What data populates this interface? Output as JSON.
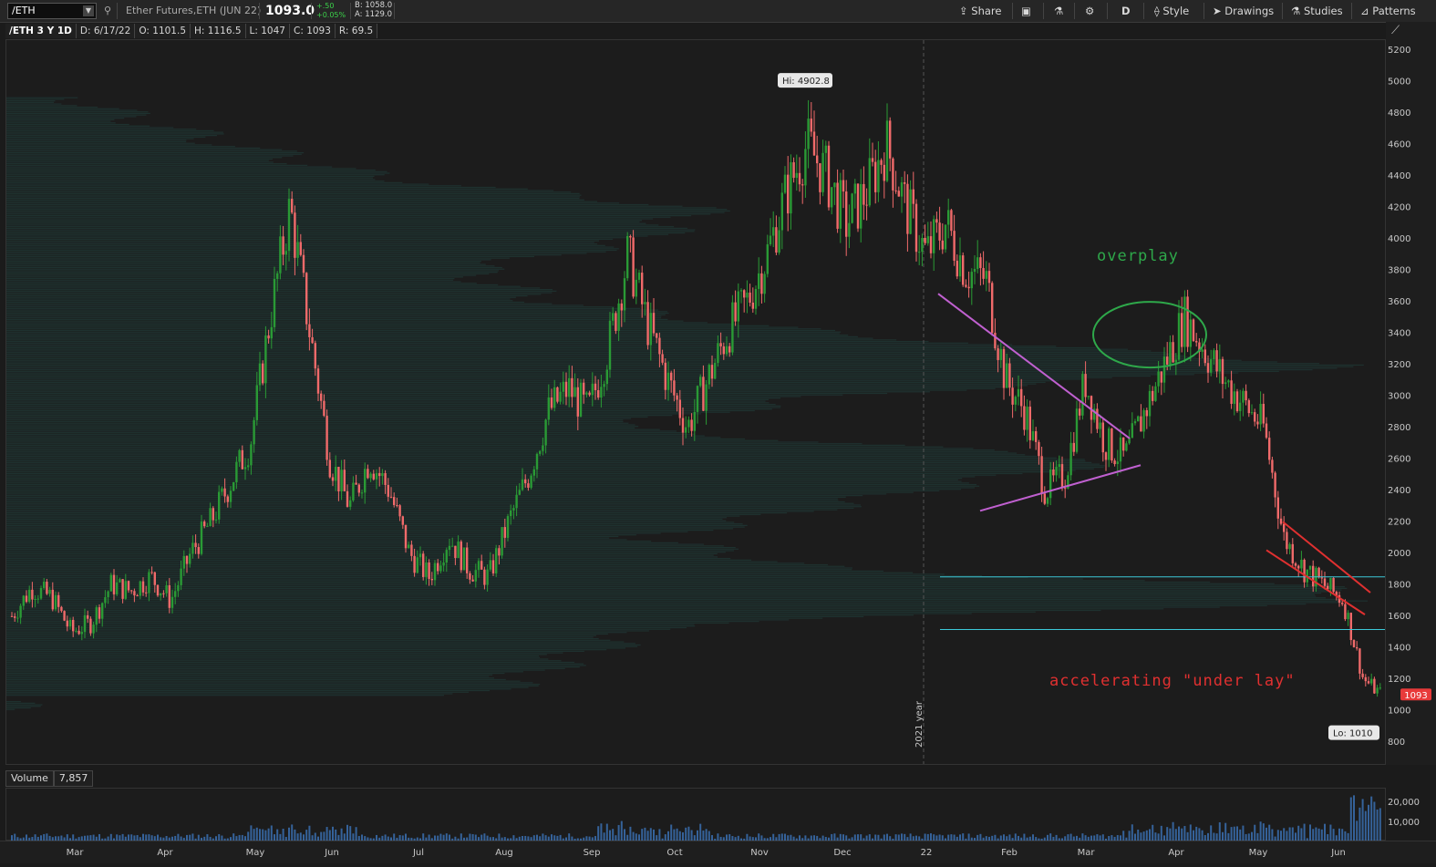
{
  "toolbar": {
    "symbol": "/ETH",
    "description": "Ether Futures,ETH (JUN 22)",
    "last_price": "1093.0",
    "change": "+.50",
    "change_pct": "+0.05%",
    "bid": "B: 1058.0",
    "ask": "A: 1129.0",
    "share_label": "Share",
    "aggregation": "D",
    "style_label": "Style",
    "drawings_label": "Drawings",
    "studies_label": "Studies",
    "patterns_label": "Patterns"
  },
  "infobar": {
    "title": "/ETH 3 Y 1D",
    "date": "D: 6/17/22",
    "open": "O: 1101.5",
    "high": "H: 1116.5",
    "low": "L: 1047",
    "close": "C: 1093",
    "range": "R: 69.5"
  },
  "volume": {
    "label": "Volume",
    "value": "7,857",
    "ticks": [
      "20,000",
      "10,000"
    ]
  },
  "chart_data": {
    "type": "candlestick",
    "price_ticks": [
      800,
      1000,
      1200,
      1400,
      1600,
      1800,
      2000,
      2200,
      2400,
      2600,
      2800,
      3000,
      3200,
      3400,
      3600,
      3800,
      4000,
      4200,
      4400,
      4600,
      4800,
      5000,
      5200
    ],
    "ylim": [
      660,
      5250
    ],
    "months": [
      "Mar",
      "Apr",
      "May",
      "Jun",
      "Jul",
      "Aug",
      "Sep",
      "Oct",
      "Nov",
      "Dec",
      "22",
      "Feb",
      "Mar",
      "Apr",
      "May",
      "Jun"
    ],
    "year_marker": {
      "label": "2021 year"
    },
    "high_label": "Hi: 4902.8",
    "high_value": 4902.8,
    "low_label": "Lo: 1010",
    "low_value": 1010,
    "last_label": "1093",
    "last_value": 1093,
    "closes": [
      1600,
      1780,
      1720,
      1500,
      1560,
      1800,
      1760,
      1850,
      1700,
      2000,
      2200,
      2450,
      2700,
      3500,
      4200,
      3400,
      2600,
      2300,
      2600,
      2400,
      2000,
      1850,
      2100,
      1900,
      1850,
      2200,
      2500,
      2900,
      3050,
      2900,
      3300,
      3900,
      3450,
      3100,
      2800,
      3100,
      3400,
      3600,
      3900,
      4300,
      4600,
      4400,
      4100,
      4300,
      4600,
      4200,
      3900,
      4100,
      3800,
      3750,
      3100,
      2900,
      2400,
      2500,
      3100,
      2700,
      2600,
      2900,
      3200,
      3500,
      3300,
      3100,
      2950,
      2800,
      2100,
      1900,
      1800,
      1700,
      1200,
      1093
    ],
    "horizontal_levels": [
      1850,
      1515
    ],
    "colors": {
      "up": "#2a9a35",
      "down": "#f06a6a",
      "triangle": "#c060d0",
      "overplay": "#2ea84a",
      "underlay": "#e03030",
      "levels": "#3cc8d8"
    },
    "annotations": [
      {
        "text": "overplay",
        "color": "#2ea84a"
      },
      {
        "text": "accelerating \"under lay\"",
        "color": "#e03030"
      }
    ]
  }
}
